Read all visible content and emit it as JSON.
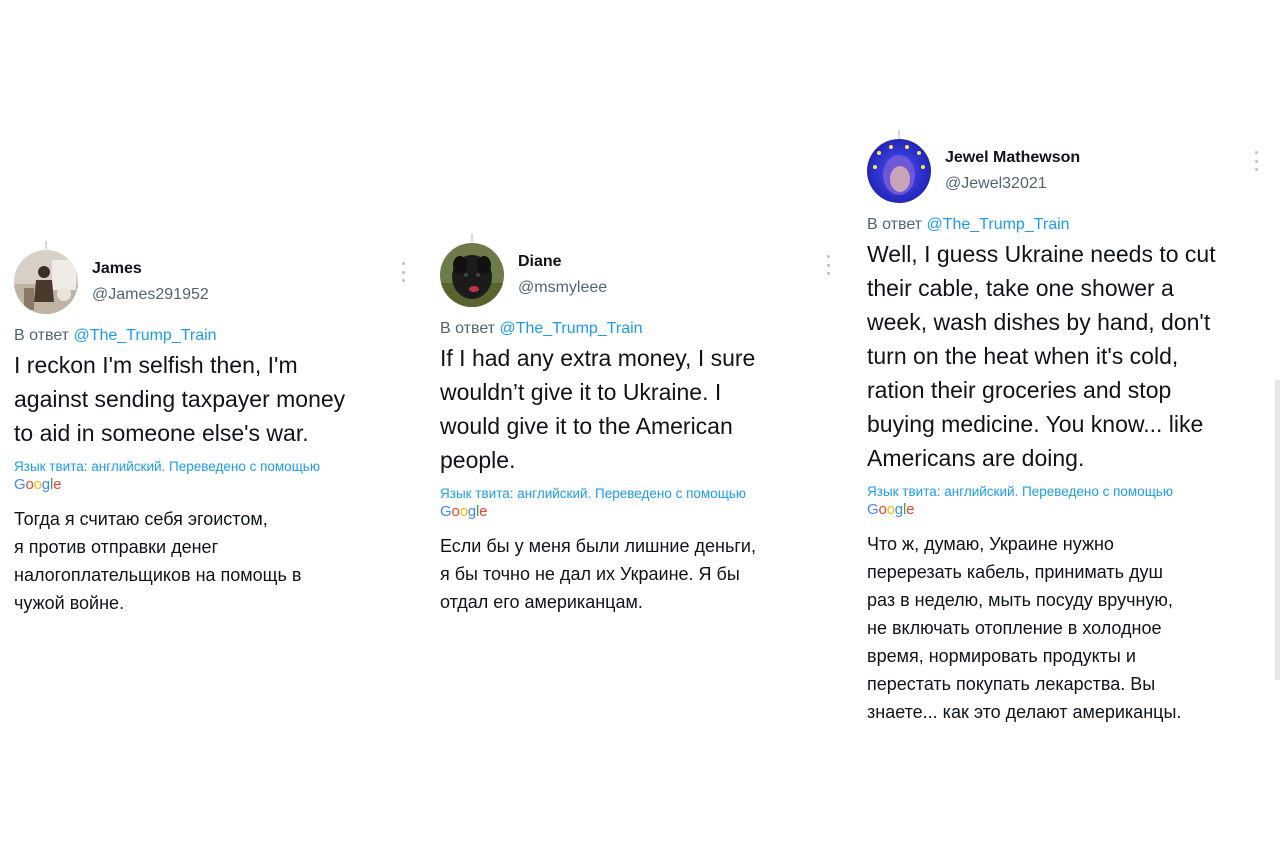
{
  "tweets": [
    {
      "display_name": "James",
      "handle": "@James291952",
      "reply_prefix": "В ответ",
      "reply_mention": "@The_Trump_Train",
      "text": "I reckon I'm selfish then, I'm\nagainst sending taxpayer money\nto aid in someone else's war.",
      "translated_note": "Язык твита: английский. Переведено с помощью",
      "translated_text": "Тогда я считаю себя эгоистом,\nя против отправки денег\nналогоплательщиков на помощь в\nчужой войне.",
      "avatar_icon": "person-photo-avatar"
    },
    {
      "display_name": "Diane",
      "handle": "@msmyleee",
      "reply_prefix": "В ответ",
      "reply_mention": "@The_Trump_Train",
      "text": "If I had any extra money, I sure\nwouldn’t give it to Ukraine. I\nwould give it to the American\npeople.",
      "translated_note": "Язык твита: английский. Переведено с помощью",
      "translated_text": "Если бы у меня были лишние деньги,\nя бы точно не дал их Украине. Я бы\nотдал его американцам.",
      "avatar_icon": "dog-photo-avatar"
    },
    {
      "display_name": "Jewel Mathewson",
      "handle": "@Jewel32021",
      "reply_prefix": "В ответ",
      "reply_mention": "@The_Trump_Train",
      "text": "Well, I guess Ukraine needs to cut\ntheir cable, take one shower a\nweek, wash dishes by hand, don't\nturn on the heat when it's cold,\nration their groceries and stop\nbuying medicine.  You know... like\nAmericans are doing.",
      "translated_note": "Язык твита: английский. Переведено с помощью",
      "translated_text": "Что ж, думаю, Украине нужно\nперерезать кабель, принимать душ\nраз в неделю, мыть посуду вручную,\nне включать отопление в холодное\nвремя, нормировать продукты и\nперестать покупать лекарства. Вы\nзнаете... как это делают американцы.",
      "avatar_icon": "woman-blue-photo-avatar"
    }
  ],
  "google_logo": {
    "letters": [
      "G",
      "o",
      "o",
      "g",
      "l",
      "e"
    ],
    "colors": [
      "#4285f4",
      "#ea4335",
      "#fbbc05",
      "#4285f4",
      "#34a853",
      "#ea4335"
    ]
  },
  "colors": {
    "link": "#1d9bf0",
    "secondary_text": "#536471",
    "primary_text": "#0f1419"
  }
}
